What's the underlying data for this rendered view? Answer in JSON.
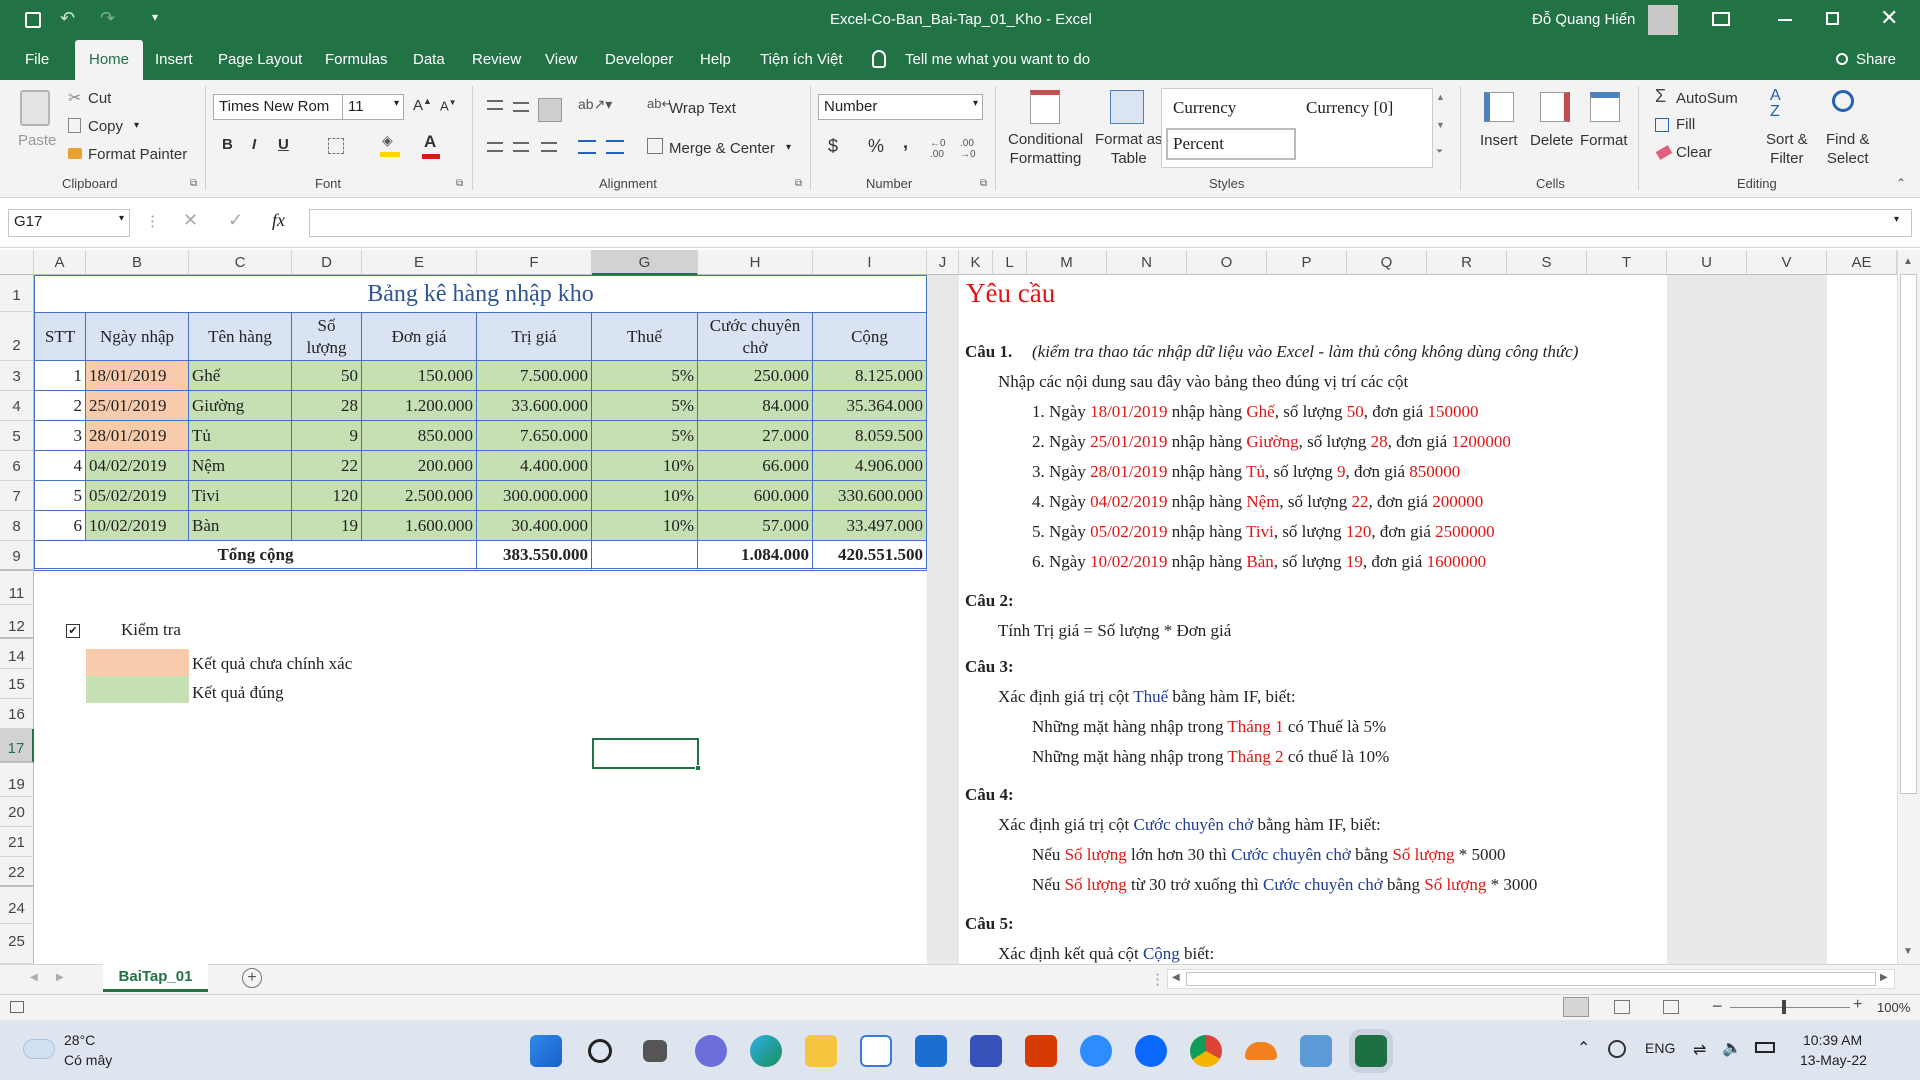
{
  "window": {
    "doc_title": "Excel-Co-Ban_Bai-Tap_01_Kho  -  Excel",
    "user": "Đỗ Quang Hiển"
  },
  "tabs": [
    "File",
    "Home",
    "Insert",
    "Page Layout",
    "Formulas",
    "Data",
    "Review",
    "View",
    "Developer",
    "Help",
    "Tiện ích Việt"
  ],
  "tell_me": "Tell me what you want to do",
  "share": "Share",
  "ribbon": {
    "clipboard": {
      "paste": "Paste",
      "cut": "Cut",
      "copy": "Copy",
      "format_painter": "Format Painter",
      "label": "Clipboard"
    },
    "font": {
      "name": "Times New Rom",
      "size": "11",
      "label": "Font",
      "bold": "B",
      "italic": "I",
      "underline": "U"
    },
    "alignment": {
      "wrap": "Wrap Text",
      "merge": "Merge & Center",
      "label": "Alignment"
    },
    "number": {
      "format": "Number",
      "currency_sym": "$",
      "percent": "%",
      "comma": ",",
      "label": "Number"
    },
    "styles": {
      "cond_fmt": "Conditional\nFormatting",
      "format_table": "Format as\nTable",
      "cells": [
        "Currency",
        "Currency [0]",
        "Percent"
      ],
      "label": "Styles"
    },
    "cells": {
      "insert": "Insert",
      "delete": "Delete",
      "format": "Format",
      "label": "Cells"
    },
    "editing": {
      "autosum": "AutoSum",
      "fill": "Fill",
      "clear": "Clear",
      "sort": "Sort &\nFilter",
      "find": "Find &\nSelect",
      "label": "Editing"
    }
  },
  "formula_bar": {
    "name_box": "G17",
    "formula": "",
    "fx": "fx"
  },
  "columns": [
    "A",
    "B",
    "C",
    "D",
    "E",
    "F",
    "G",
    "H",
    "I",
    "J",
    "K",
    "L",
    "M",
    "N",
    "O",
    "P",
    "Q",
    "R",
    "S",
    "T",
    "U",
    "V",
    "AE"
  ],
  "rows": [
    "1",
    "2",
    "3",
    "4",
    "5",
    "6",
    "7",
    "8",
    "9",
    "11",
    "12",
    "14",
    "15",
    "16",
    "17",
    "19",
    "20",
    "21",
    "22",
    "24",
    "25"
  ],
  "table": {
    "title": "Bảng kê hàng nhập kho",
    "headers": [
      "STT",
      "Ngày nhập",
      "Tên hàng",
      "Số\nlượng",
      "Đơn giá",
      "Trị giá",
      "Thuế",
      "Cước chuyên\nchở",
      "Cộng"
    ],
    "rows": [
      [
        "1",
        "18/01/2019",
        "Ghế",
        "50",
        "150.000",
        "7.500.000",
        "5%",
        "250.000",
        "8.125.000"
      ],
      [
        "2",
        "25/01/2019",
        "Giường",
        "28",
        "1.200.000",
        "33.600.000",
        "5%",
        "84.000",
        "35.364.000"
      ],
      [
        "3",
        "28/01/2019",
        "Tủ",
        "9",
        "850.000",
        "7.650.000",
        "5%",
        "27.000",
        "8.059.500"
      ],
      [
        "4",
        "04/02/2019",
        "Nệm",
        "22",
        "200.000",
        "4.400.000",
        "10%",
        "66.000",
        "4.906.000"
      ],
      [
        "5",
        "05/02/2019",
        "Tivi",
        "120",
        "2.500.000",
        "300.000.000",
        "10%",
        "600.000",
        "330.600.000"
      ],
      [
        "6",
        "10/02/2019",
        "Bàn",
        "19",
        "1.600.000",
        "30.400.000",
        "10%",
        "57.000",
        "33.497.000"
      ]
    ],
    "total_label": "Tổng cộng",
    "total_trigia": "383.550.000",
    "total_cuoc": "1.084.000",
    "total_cong": "420.551.500"
  },
  "check": {
    "label": "Kiểm tra",
    "checkmark": "✔",
    "wrong": "Kết quả chưa chính xác",
    "right": "Kết quả đúng"
  },
  "colors": {
    "accent": "#217346",
    "green_cell": "#c6e0b4",
    "orange_cell": "#f8cbad",
    "red": "#e31414",
    "blue": "#1f3c94"
  },
  "req": {
    "title": "Yêu cầu",
    "q1": "Câu 1.",
    "q1_note": "(kiểm tra thao tác nhập dữ liệu vào Excel - làm thủ công không dùng công thức)",
    "q1_intro": "Nhập các nội dung sau đây vào bảng theo đúng vị trí các cột",
    "items": [
      {
        "n": "1. Ngày ",
        "date": "18/01/2019",
        "a": " nhập hàng ",
        "item": "Ghế",
        "b": ", số lượng ",
        "qty": "50",
        "c": ", đơn giá ",
        "price": "150000"
      },
      {
        "n": "2. Ngày ",
        "date": "25/01/2019",
        "a": " nhập hàng ",
        "item": "Giường",
        "b": ", số lượng ",
        "qty": "28",
        "c": ", đơn giá ",
        "price": "1200000"
      },
      {
        "n": "3. Ngày ",
        "date": "28/01/2019",
        "a": " nhập hàng ",
        "item": "Tủ",
        "b": ", số lượng ",
        "qty": "9",
        "c": ", đơn giá ",
        "price": "850000"
      },
      {
        "n": "4. Ngày ",
        "date": "04/02/2019",
        "a": " nhập hàng ",
        "item": "Nệm",
        "b": ", số lượng ",
        "qty": "22",
        "c": ", đơn giá ",
        "price": "200000"
      },
      {
        "n": "5. Ngày ",
        "date": "05/02/2019",
        "a": " nhập hàng ",
        "item": "Tivi",
        "b": ", số lượng ",
        "qty": "120",
        "c": ", đơn giá ",
        "price": "2500000"
      },
      {
        "n": "6. Ngày ",
        "date": "10/02/2019",
        "a": " nhập hàng ",
        "item": "Bàn",
        "b": ", số lượng ",
        "qty": "19",
        "c": ", đơn giá ",
        "price": "1600000"
      }
    ],
    "q2": "Câu 2:",
    "q2_text": "Tính Trị giá = Số lượng * Đơn giá",
    "q3": "Câu 3:",
    "q3_a": "Xác định giá trị cột ",
    "q3_b": "Thuế",
    "q3_c": " bằng hàm IF, biết:",
    "q3_l1a": "Những mặt hàng nhập trong ",
    "q3_l1b": "Tháng 1",
    "q3_l1c": " có Thuế là 5%",
    "q3_l2a": "Những mặt hàng nhập trong ",
    "q3_l2b": "Tháng 2",
    "q3_l2c": " có thuế là 10%",
    "q4": "Câu 4:",
    "q4_a": "Xác định giá trị cột ",
    "q4_b": "Cước chuyên chở",
    "q4_c": " bằng hàm IF, biết:",
    "q4_l1": [
      "Nếu ",
      "Số lượng",
      " lớn hơn 30 thì ",
      "Cước chuyên chở",
      " bằng ",
      "Số lượng",
      " * 5000"
    ],
    "q4_l2": [
      "Nếu ",
      "Số lượng",
      " từ 30 trở xuống thì ",
      "Cước chuyên chở",
      " bằng ",
      "Số lượng",
      " * 3000"
    ],
    "q5": "Câu 5:",
    "q5_a": "Xác định kết quả cột ",
    "q5_b": "Cộng",
    "q5_c": " biết:"
  },
  "sheet_tab": "BaiTap_01",
  "status": {
    "zoom": "100%"
  },
  "taskbar": {
    "temp": "28°C",
    "weather": "Có mây",
    "lang": "ENG",
    "time": "10:39 AM",
    "date": "13-May-22"
  }
}
